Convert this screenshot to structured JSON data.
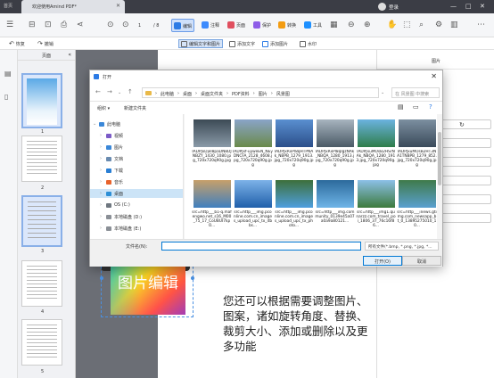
{
  "titlebar": {
    "home_label": "首页",
    "tab_title": "欢迎使用Amind PDF*",
    "user_label": "登录"
  },
  "toolbar": {
    "page_current": "1",
    "page_total": "/ 8",
    "tools": [
      {
        "label": "编辑",
        "color": "#2c7be5"
      },
      {
        "label": "注释",
        "color": "#3d8bfd"
      },
      {
        "label": "页面",
        "color": "#e04f5f"
      },
      {
        "label": "保护",
        "color": "#8e5de8"
      },
      {
        "label": "转换",
        "color": "#f39c12"
      },
      {
        "label": "工具",
        "color": "#1e90ff"
      }
    ]
  },
  "toolbar2": {
    "undo": "恢复",
    "redo": "撤销",
    "edit_text_image": "编辑文字和图片",
    "add_text": "添加文字",
    "add_image": "添加图片",
    "watermark": "水印"
  },
  "thumbnails": {
    "header": "页面",
    "pages": [
      "1",
      "2",
      "3",
      "4",
      "5"
    ],
    "selected": [
      1,
      3
    ]
  },
  "right_panel": {
    "header": "图片"
  },
  "document": {
    "image_text": "图片编辑",
    "paragraph": "您还可以根据需要调整图片、图案，诸如旋转角度、替换、裁剪大小、添加或删除以及更多功能"
  },
  "dialog": {
    "title": "打开",
    "breadcrumb": [
      "此电脑",
      "桌面",
      "桌面文件夹",
      "PDF资料",
      "图片",
      "风景图"
    ],
    "search_placeholder": "在 风景图 中搜索",
    "organize": "组织 ▾",
    "new_folder": "新建文件夹",
    "tree": [
      {
        "label": "此电脑",
        "level": 0,
        "color": "#3a87d8",
        "expanded": true
      },
      {
        "label": "视频",
        "level": 1,
        "color": "#7b5bc7"
      },
      {
        "label": "图片",
        "level": 1,
        "color": "#3a87d8"
      },
      {
        "label": "文档",
        "level": 1,
        "color": "#6a8bb0"
      },
      {
        "label": "下载",
        "level": 1,
        "color": "#2a7fd4"
      },
      {
        "label": "音乐",
        "level": 1,
        "color": "#e8632c"
      },
      {
        "label": "桌面",
        "level": 1,
        "color": "#2d8fd6",
        "selected": true
      },
      {
        "label": "OS (C:)",
        "level": 1,
        "color": "#6f7780"
      },
      {
        "label": "本地磁盘 (D:)",
        "level": 1,
        "color": "#8a8f96"
      },
      {
        "label": "本地磁盘 (E:)",
        "level": 1,
        "color": "#8a8f96"
      }
    ],
    "files": [
      {
        "name": "IADPJxDjeI8paDN8DJNBZY_1430_1080.jpg_720x720q90g.jpg",
        "c1": "#8a9aa8",
        "c2": "#3c4a55"
      },
      {
        "name": "IADPJxf-uyweEN_NEyDNCFA_2128_4608.jpg_720x720q90g.jpg",
        "c1": "#6a8a4a",
        "c2": "#8aa4c8"
      },
      {
        "name": "IADPJxRxPl8qHTPNAk_NBPB_1279_1913.jpg_720x720q90g.jpg",
        "c1": "#2b4f8a",
        "c2": "#5a8fd0"
      },
      {
        "name": "IADPJxRxPl8qIgzNAk_NBQA_1280_1913.jpg_720x720q90g.jpg",
        "c1": "#4a5a66",
        "c2": "#a7b4bf"
      },
      {
        "name": "IADPJxuMOsB2HSrNAk_NBQA_1280_1913.jpg_720x720q90g.jpg",
        "c1": "#2e7d4a",
        "c2": "#6bb3e0"
      },
      {
        "name": "IADPJxuMOsB2HT3NA1TNBPB_1279_852.jpg_720x720q90g.jpg",
        "c1": "#3a4a5a",
        "c2": "#7c8fa0"
      },
      {
        "name": "src=http___b1-q.mafengwo.net_s16_M00_75_17_CoUBUI7kpO...",
        "c1": "#3f7fbf",
        "c2": "#c7a06a"
      },
      {
        "name": "src=http___img.pconline.com.cn_images_upload_upc_tx_itbbs...",
        "c1": "#1f5faa",
        "c2": "#7db2e8"
      },
      {
        "name": "src=http___img.pconline.com.cn_images_upload_upc_tx_photo...",
        "c1": "#4f9fdf",
        "c2": "#3d6f3a"
      },
      {
        "name": "src=http___img.community_0139e45a07a0a9a80121...",
        "c1": "#6fb5e8",
        "c2": "#2c6a9c"
      },
      {
        "name": "src=http___img1.qunarzz.com_travel_poi_1806_37_76c16f86...",
        "c1": "#3c7a3c",
        "c2": "#8cc0e8"
      },
      {
        "name": "src=http___inews.gtimg.com_newsapp_bt_0_13895275010_10...",
        "c1": "#5aa0d0",
        "c2": "#3f7a4a"
      }
    ],
    "filename_label": "文件名(N):",
    "filename_value": "",
    "filter": "所有文件(*.bmp, *.png, *.jpg, *...",
    "open_button": "打开(O)",
    "cancel_button": "取消"
  }
}
